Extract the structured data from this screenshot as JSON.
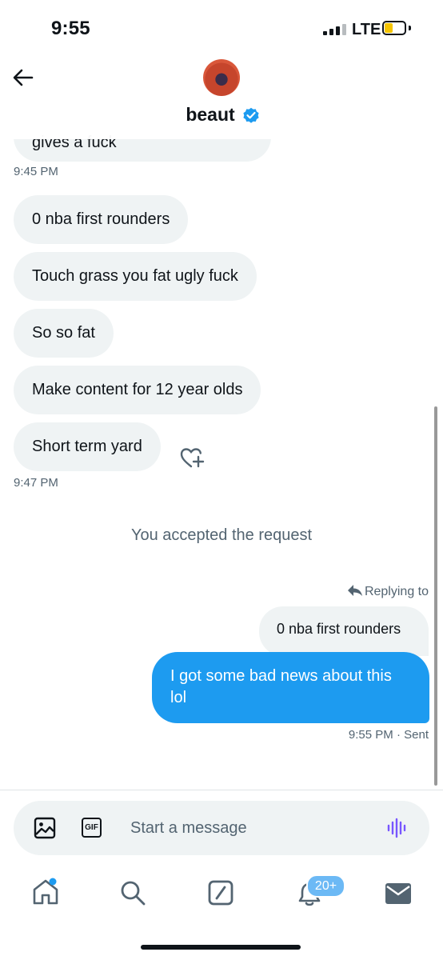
{
  "status_bar": {
    "time": "9:55",
    "network": "LTE"
  },
  "header": {
    "name": "beaut"
  },
  "messages": {
    "partial_text": "gives a fuck",
    "ts1": "9:45 PM",
    "m1": "0 nba first rounders",
    "m2": "Touch grass you fat ugly fuck",
    "m3": "So so fat",
    "m4": "Make content for 12 year olds",
    "m5": "Short term yard",
    "ts2": "9:47 PM",
    "system": "You accepted the request",
    "reply_label": "Replying to",
    "quoted": "0 nba first rounders",
    "sent_line1": "I got some bad news about this",
    "sent_line2": "lol",
    "sent_time": "9:55 PM",
    "sent_status": "· Sent"
  },
  "composer": {
    "placeholder": "Start a message",
    "gif_label": "GIF"
  },
  "nav": {
    "notif_badge": "20+"
  },
  "colors": {
    "accent": "#1d9bf0",
    "bubble_in": "#eff3f4",
    "voice": "#7856ff"
  }
}
